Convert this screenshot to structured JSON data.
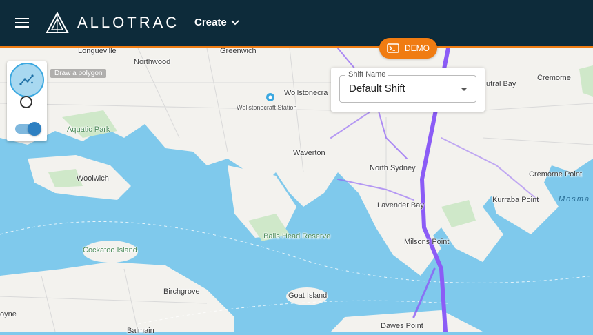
{
  "header": {
    "brand": "ALLOTRAC",
    "create_label": "Create"
  },
  "demo_badge": {
    "label": "DEMO"
  },
  "draw_tools": {
    "polygon_tooltip": "Draw a polygon",
    "toggle_on": true
  },
  "shift": {
    "field_label": "Shift Name",
    "value": "Default Shift"
  },
  "map": {
    "labels": {
      "longueville": "Longueville",
      "greenwich": "Greenwich",
      "northwood": "Northwood",
      "wollstonecraft": "Wollstonecra",
      "wollstonecraft_station": "Wollstonecraft Station",
      "neutral_bay": "utral Bay",
      "cremorne": "Cremorne",
      "aquatic_park": "Aquatic Park",
      "waverton": "Waverton",
      "north_sydney": "North Sydney",
      "cremorne_point": "Cremorne Point",
      "woolwich": "Woolwich",
      "lavender_bay": "Lavender Bay",
      "kurraba_point": "Kurraba Point",
      "mosman": "Mosma",
      "balls_head_reserve": "Balls Head Reserve",
      "milsons_point": "Milsons Point",
      "cockatoo_island": "Cockatoo Island",
      "birchgrove": "Birchgrove",
      "goat_island": "Goat Island",
      "oyne": "oyne",
      "balmain": "Balmain",
      "dawes_point": "Dawes Point"
    },
    "colors": {
      "water": "#7fc9ec",
      "land": "#f3f2ee",
      "park": "#cfe8c9",
      "route": "#8b5cf6"
    }
  },
  "colors": {
    "header_bg": "#0d2b3a",
    "accent": "#f07c12"
  }
}
